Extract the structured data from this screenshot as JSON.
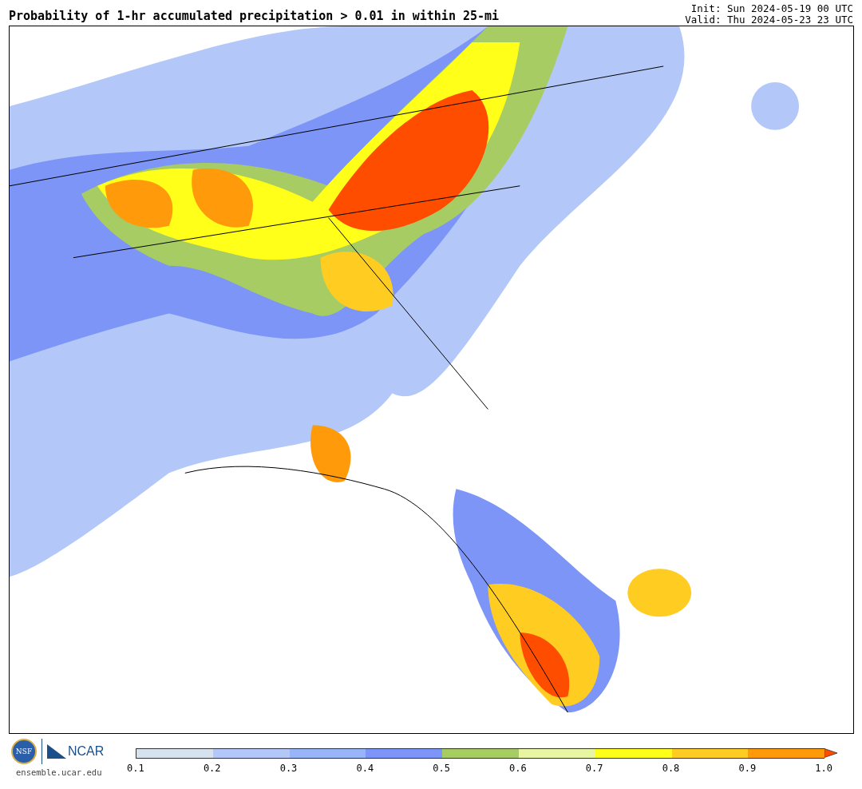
{
  "header": {
    "title": "Probability of 1-hr accumulated precipitation > 0.01 in within 25-mi",
    "init": "Init: Sun 2024-05-19 00 UTC",
    "valid": "Valid: Thu 2024-05-23 23 UTC"
  },
  "footer": {
    "logo_nsf": "NSF",
    "logo_ncar": "NCAR",
    "site": "ensemble.ucar.edu"
  },
  "legend": {
    "bins": [
      {
        "color": "#d6e2ee"
      },
      {
        "color": "#b3c8f8"
      },
      {
        "color": "#97b5f8"
      },
      {
        "color": "#7d95f6"
      },
      {
        "color": "#a8cc64"
      },
      {
        "color": "#e8f5a3"
      },
      {
        "color": "#ffff1a"
      },
      {
        "color": "#ffcc22"
      },
      {
        "color": "#ff9a0a"
      },
      {
        "kind": "arrow",
        "color": "#ff4d00"
      }
    ],
    "ticks": [
      "0.1",
      "0.2",
      "0.3",
      "0.4",
      "0.5",
      "0.6",
      "0.7",
      "0.8",
      "0.9",
      "1.0"
    ]
  }
}
